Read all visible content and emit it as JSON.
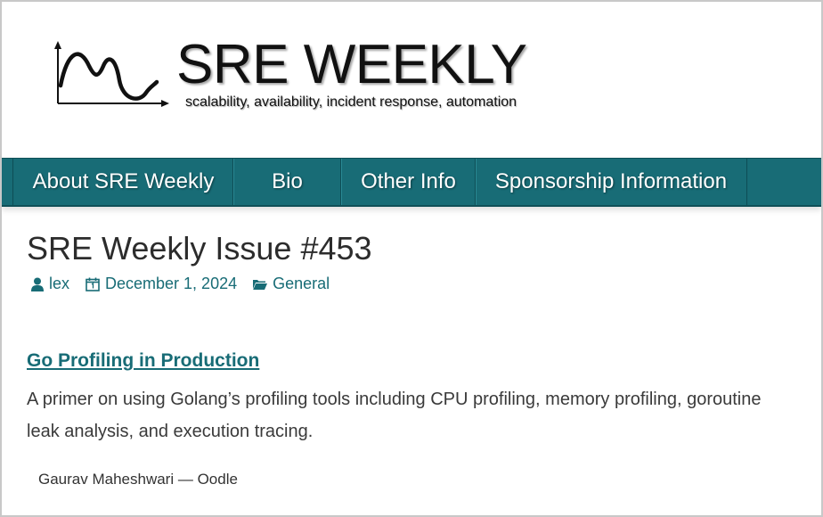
{
  "header": {
    "site_title": "SRE WEEKLY",
    "tagline": "scalability, availability, incident response, automation"
  },
  "nav": {
    "items": [
      {
        "label": "About SRE Weekly"
      },
      {
        "label": "Bio"
      },
      {
        "label": "Other Info"
      },
      {
        "label": "Sponsorship Information"
      }
    ]
  },
  "post": {
    "title": "SRE Weekly Issue #453",
    "meta": {
      "author": "lex",
      "date": "December 1, 2024",
      "category": "General"
    }
  },
  "article": {
    "link_title": "Go Profiling in Production",
    "description": "A primer on using Golang’s profiling tools including CPU profiling, memory profiling, goroutine leak analysis, and execution tracing.",
    "source": "Gaurav Maheshwari — Oodle"
  },
  "colors": {
    "accent": "#186c76",
    "nav_background": "#186c76",
    "text": "#333333"
  },
  "icons": [
    "logo-graph-icon",
    "user-icon",
    "calendar-icon",
    "folder-icon"
  ]
}
